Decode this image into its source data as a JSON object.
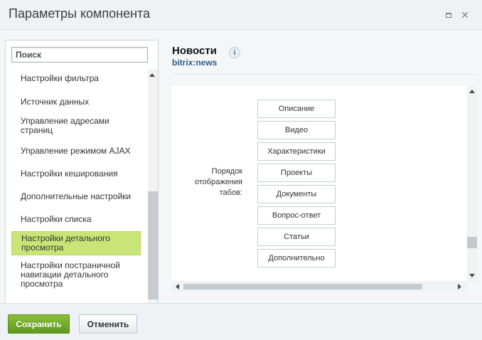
{
  "dialog": {
    "title": "Параметры компонента",
    "maximize_icon": "maximize-icon",
    "close_icon": "close-icon"
  },
  "sidebar": {
    "search_placeholder": "Поиск",
    "items": [
      {
        "label": "Настройки фильтра",
        "active": false
      },
      {
        "label": "Источник данных",
        "active": false
      },
      {
        "label": "Управление адресами страниц",
        "active": false
      },
      {
        "label": "Управление режимом AJAX",
        "active": false
      },
      {
        "label": "Настройки кеширования",
        "active": false
      },
      {
        "label": "Дополнительные настройки",
        "active": false
      },
      {
        "label": "Настройки списка",
        "active": false
      },
      {
        "label": "Настройки детального просмотра",
        "active": true
      },
      {
        "label": "Настройки постраничной навигации детального просмотра",
        "active": false
      }
    ]
  },
  "component": {
    "name": "Новости",
    "code": "bitrix:news",
    "info_icon": "info-icon"
  },
  "tab_order": {
    "label": "Порядок отображения табов:",
    "tabs": [
      "Описание",
      "Видео",
      "Характеристики",
      "Проекты",
      "Документы",
      "Вопрос-ответ",
      "Статьи",
      "Дополнительно"
    ]
  },
  "footer": {
    "save_label": "Сохранить",
    "cancel_label": "Отменить"
  },
  "colors": {
    "active_item": "#cae478",
    "save_button": "#6fa82a",
    "component_code": "#2d5e8a"
  }
}
